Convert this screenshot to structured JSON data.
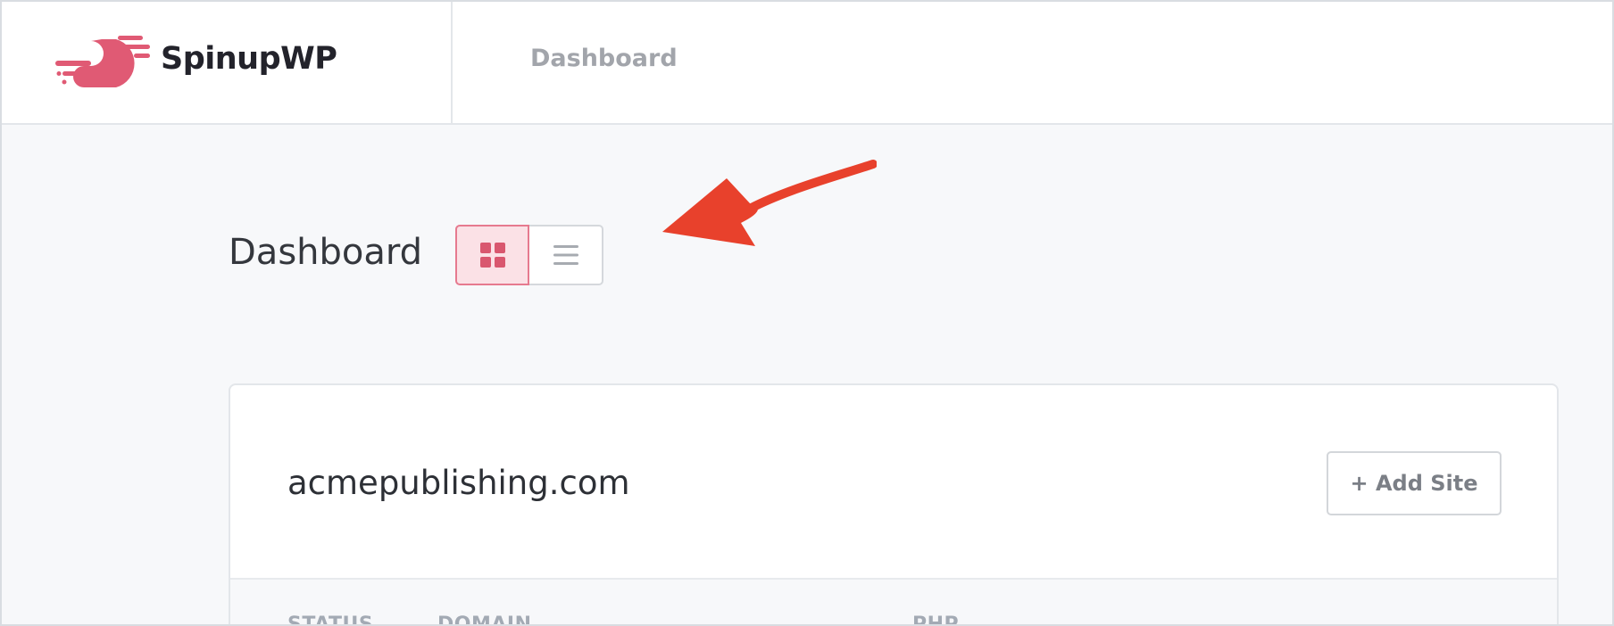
{
  "app": {
    "brand_name": "SpinupWP",
    "brand_color": "#e05a74"
  },
  "nav": {
    "dashboard_label": "Dashboard"
  },
  "page": {
    "title": "Dashboard"
  },
  "view_toggle": {
    "options": [
      {
        "name": "grid-view",
        "icon": "grid-icon",
        "selected": true
      },
      {
        "name": "list-view",
        "icon": "list-icon",
        "selected": false
      }
    ]
  },
  "annotation": {
    "arrow_color": "#e8412c"
  },
  "server_card": {
    "name": "acmepublishing.com",
    "add_site_label": "+ Add Site",
    "columns": [
      "STATUS",
      "DOMAIN",
      "PHP"
    ]
  }
}
